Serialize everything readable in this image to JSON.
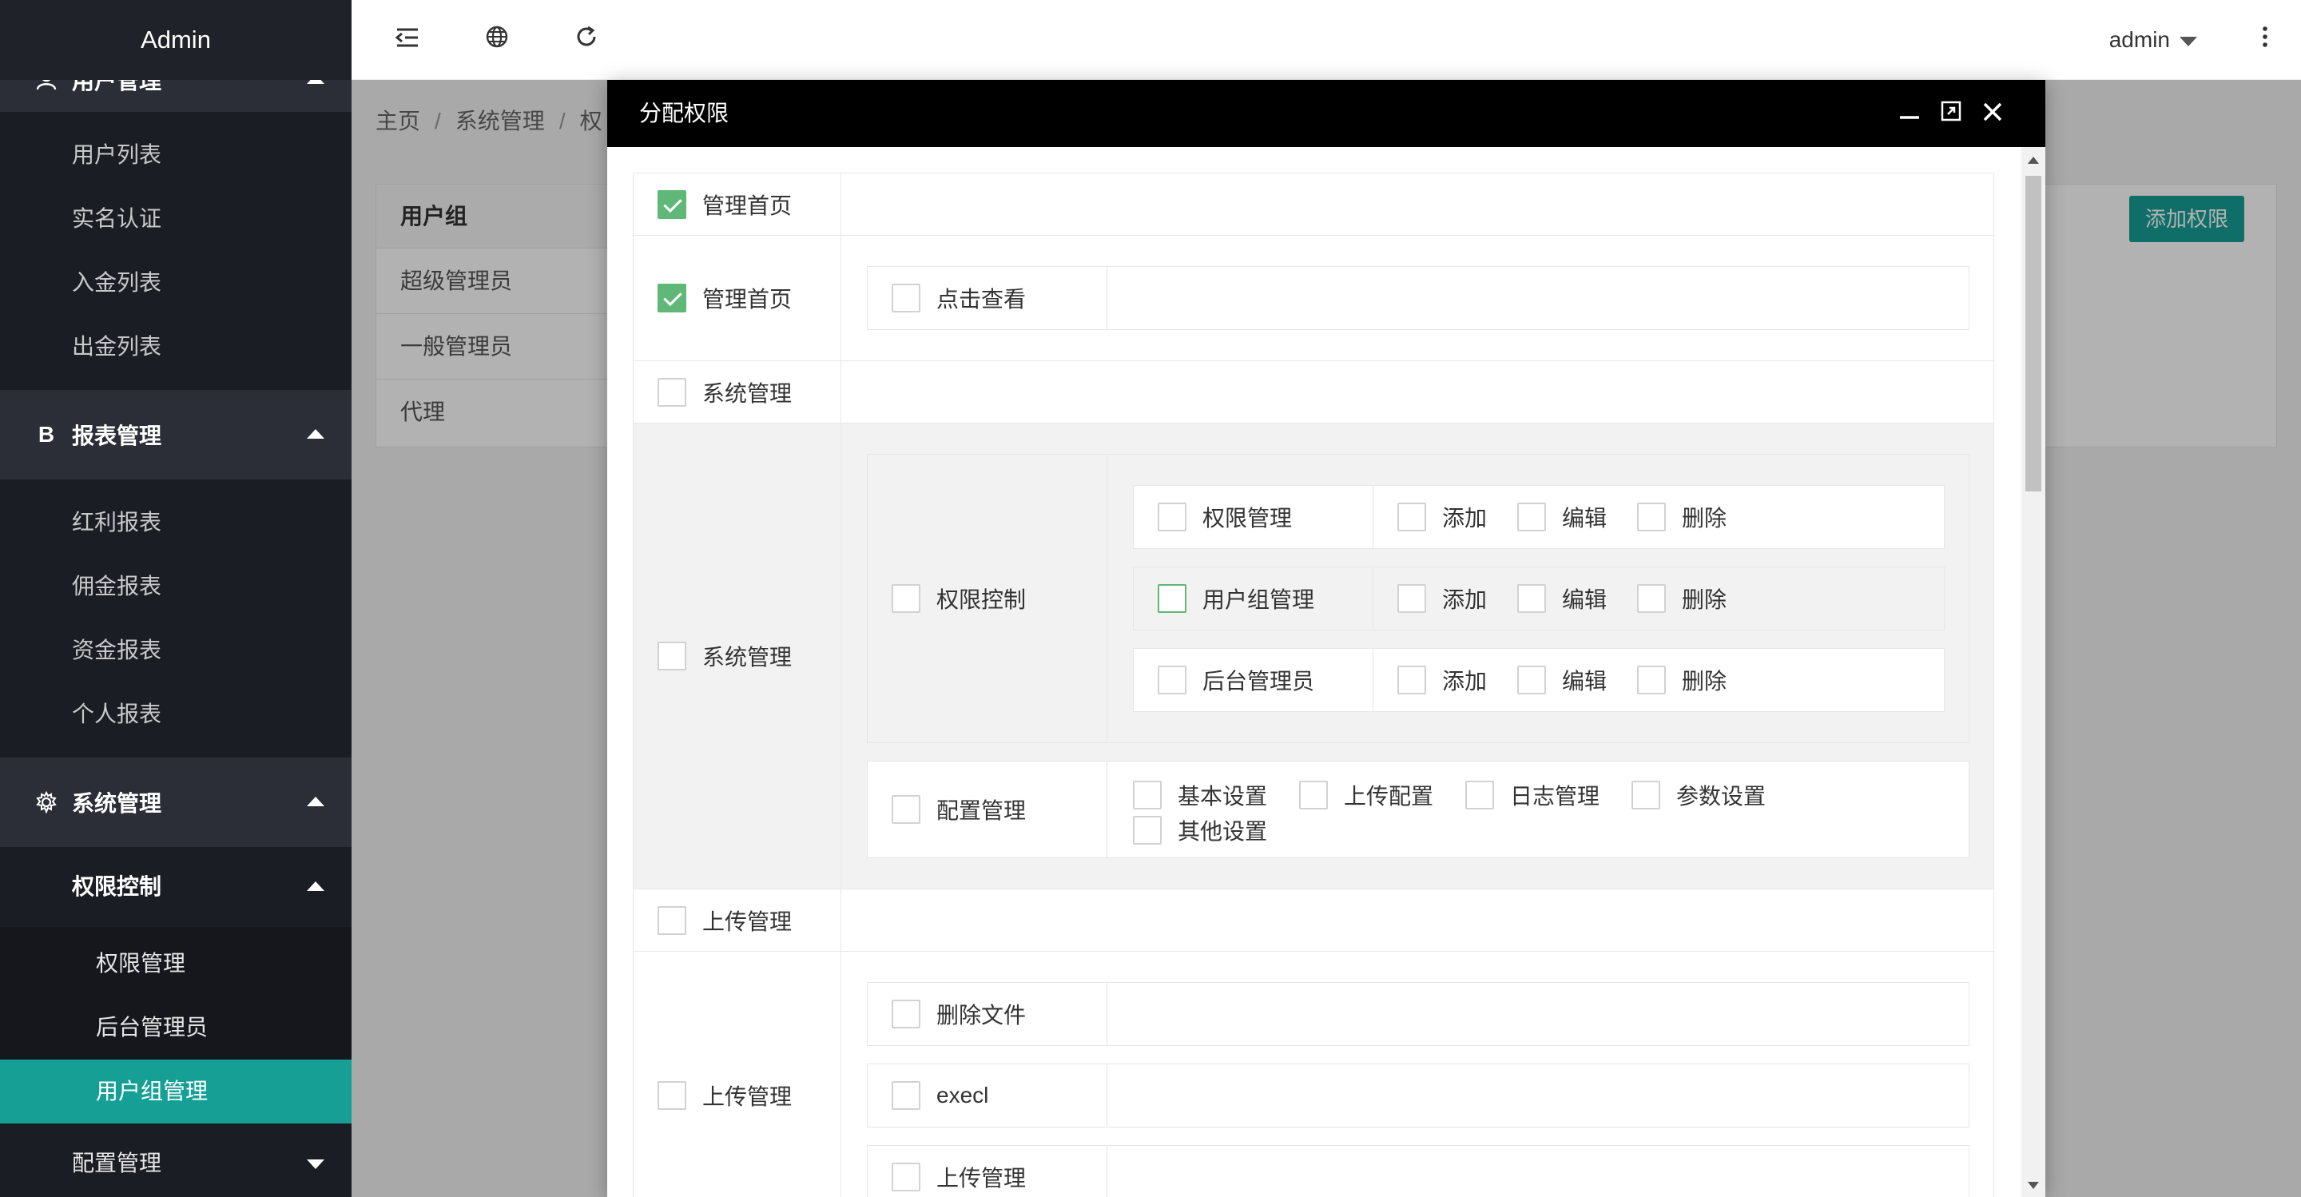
{
  "app": {
    "title": "Admin"
  },
  "sidebar": {
    "group_users": {
      "label": "用户管理",
      "icon": "user-icon",
      "items": [
        "用户列表",
        "实名认证",
        "入金列表",
        "出金列表"
      ]
    },
    "group_reports": {
      "label": "报表管理",
      "icon_text": "B",
      "items": [
        "红利报表",
        "佣金报表",
        "资金报表",
        "个人报表"
      ]
    },
    "group_system": {
      "label": "系统管理",
      "icon": "gear-icon",
      "sub_access": {
        "label": "权限控制",
        "items": [
          "权限管理",
          "后台管理员",
          "用户组管理"
        ],
        "active": "用户组管理"
      },
      "sub_config": {
        "label": "配置管理"
      }
    }
  },
  "topbar": {
    "user": "admin"
  },
  "breadcrumb": {
    "home": "主页",
    "system": "系统管理",
    "current": "权"
  },
  "card": {
    "column_header": "用户组",
    "rows": [
      "超级管理员",
      "一般管理员",
      "代理"
    ],
    "add_button": "添加权限"
  },
  "modal": {
    "title": "分配权限",
    "perm": {
      "home_top": "管理首页",
      "home": "管理首页",
      "home_view": "点击查看",
      "system_top": "系统管理",
      "system": "系统管理",
      "access_control": "权限控制",
      "perm_mgmt": "权限管理",
      "usergroup_mgmt": "用户组管理",
      "admin_mgmt": "后台管理员",
      "add": "添加",
      "edit": "编辑",
      "delete": "删除",
      "config_mgmt": "配置管理",
      "basic": "基本设置",
      "upload_cfg": "上传配置",
      "log_mgmt": "日志管理",
      "param": "参数设置",
      "other": "其他设置",
      "upload_top": "上传管理",
      "upload": "上传管理",
      "delete_file": "删除文件",
      "execl": "execl",
      "upload_sub": "上传管理"
    }
  },
  "colors": {
    "accent": "#16a095",
    "checked": "#5fb878",
    "sidebar_bg": "#20222a",
    "modal_header": "#000000"
  }
}
